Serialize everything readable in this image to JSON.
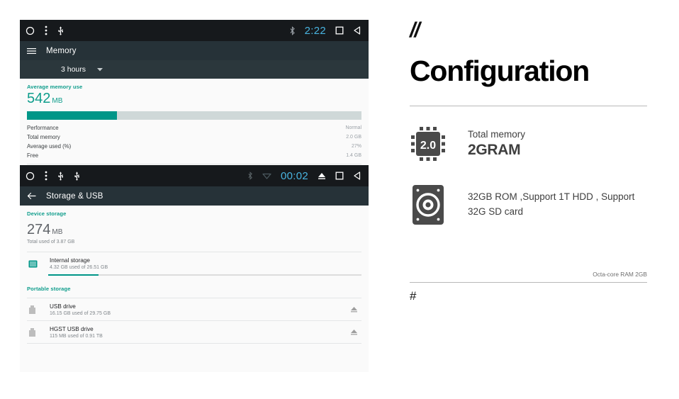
{
  "memory_screenshot": {
    "statusbar": {
      "left_icons": [
        "home-circle-icon",
        "overflow-menu-icon",
        "usb-icon"
      ],
      "bluetooth_icon": "bluetooth-icon",
      "time": "2:22",
      "recents_icon": "recents-square-icon",
      "back_icon": "back-triangle-icon"
    },
    "appbar": {
      "menu_icon": "hamburger-icon",
      "title": "Memory"
    },
    "spinner": {
      "label": "3 hours",
      "caret_icon": "chevron-down-icon"
    },
    "section_label": "Average memory use",
    "value": "542",
    "unit": "MB",
    "usage_percent": 27,
    "stats": [
      {
        "label": "Performance",
        "value": "Normal"
      },
      {
        "label": "Total memory",
        "value": "2.0 GB"
      },
      {
        "label": "Average used (%)",
        "value": "27%"
      },
      {
        "label": "Free",
        "value": "1.4 GB"
      }
    ]
  },
  "storage_screenshot": {
    "statusbar": {
      "left_icons": [
        "home-circle-icon",
        "overflow-menu-icon",
        "usb-icon",
        "usb-icon"
      ],
      "bluetooth_icon": "bluetooth-icon",
      "wifi_icon": "wifi-icon",
      "time": "00:02",
      "eject_icon": "eject-icon",
      "recents_icon": "recents-square-icon",
      "back_icon": "back-triangle-icon"
    },
    "appbar": {
      "back_icon": "back-arrow-icon",
      "title": "Storage & USB"
    },
    "device_section_label": "Device storage",
    "value": "274",
    "unit": "MB",
    "total_used": "Total used of 3.87 GB",
    "internal": {
      "icon": "storage-bars-icon",
      "title": "Internal storage",
      "subtitle": "4.32 GB used of 26.51 GB",
      "fill_percent": 16
    },
    "portable_section_label": "Portable storage",
    "drives": [
      {
        "icon": "usb-drive-icon",
        "title": "USB drive",
        "subtitle": "16.15 GB used of 29.75 GB",
        "action_icon": "eject-icon"
      },
      {
        "icon": "usb-drive-icon",
        "title": "HGST USB drive",
        "subtitle": "115 MB used of 0.91 TB",
        "action_icon": "eject-icon"
      }
    ]
  },
  "configuration": {
    "slashes": "//",
    "title": "Configuration",
    "specs": [
      {
        "icon": "cpu-chip-icon",
        "icon_text": "2.0",
        "label": "Total memory",
        "value": "2GRAM"
      },
      {
        "icon": "hard-disk-icon",
        "text": "32GB ROM ,Support 1T HDD , Support 32G SD card"
      }
    ],
    "footer_note": "Octa-core RAM 2GB",
    "hash": "#"
  },
  "colors": {
    "teal": "#009688",
    "teal_text": "#0f9d8c",
    "statusbar_bg": "#16191c",
    "appbar_bg": "#263238",
    "tabbar_bg": "#2b373c",
    "time_blue": "#49b4e0"
  }
}
